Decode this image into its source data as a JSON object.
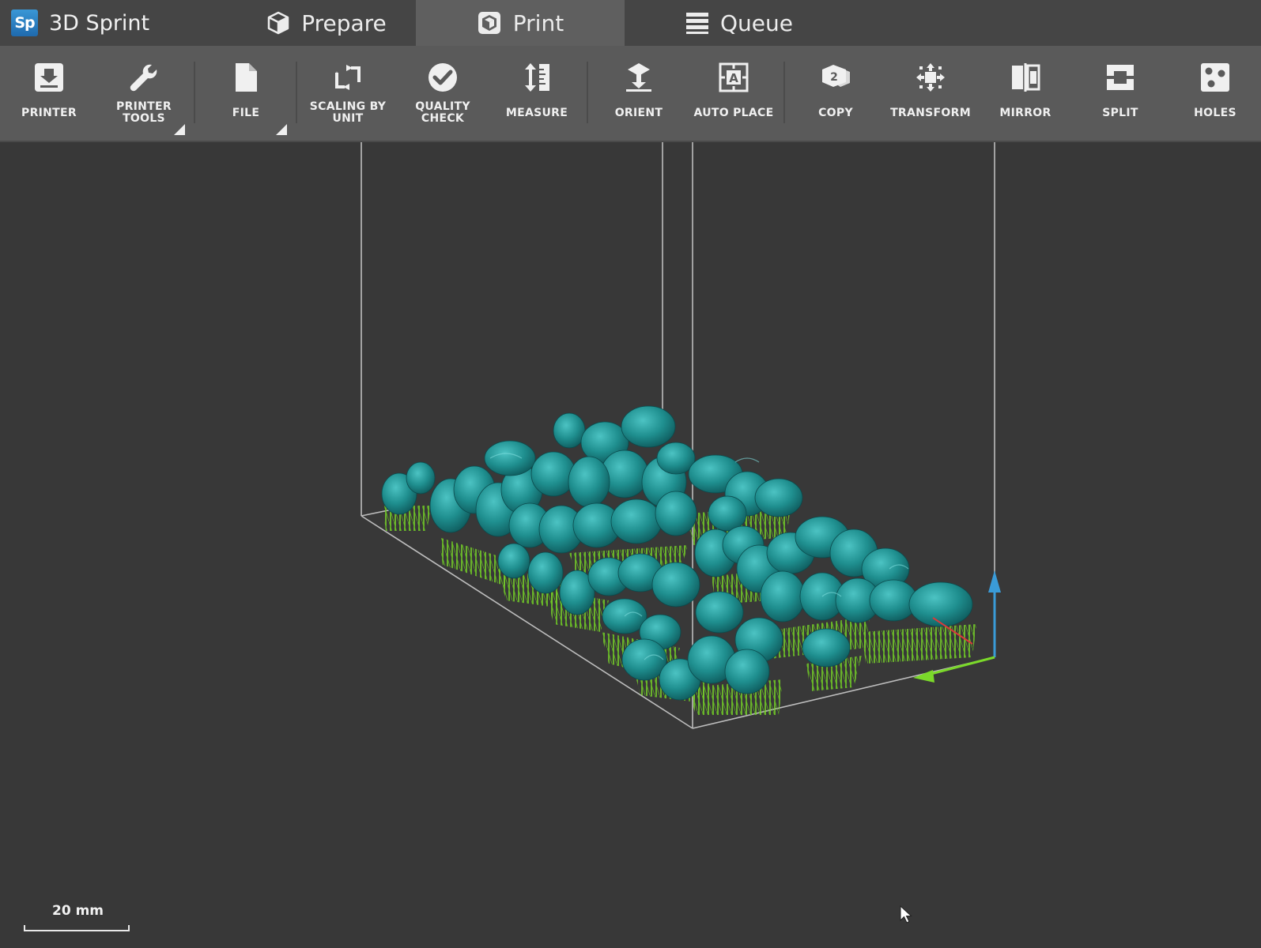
{
  "app": {
    "logo_text": "Sp",
    "title": "3D Sprint"
  },
  "tabs": [
    {
      "label": "Prepare",
      "icon": "cube-icon",
      "active": false
    },
    {
      "label": "Print",
      "icon": "print-cube-icon",
      "active": true
    },
    {
      "label": "Queue",
      "icon": "queue-list-icon",
      "active": false
    }
  ],
  "toolbar": {
    "printer": {
      "label": "PRINTER",
      "icon": "printer-icon"
    },
    "printer_tools": {
      "label_line1": "PRINTER",
      "label_line2": "TOOLS",
      "icon": "wrench-icon"
    },
    "file": {
      "label": "FILE",
      "icon": "file-icon"
    },
    "scaling_by_unit": {
      "label_line1": "SCALING BY",
      "label_line2": "UNIT",
      "icon": "scaling-icon"
    },
    "quality_check": {
      "label_line1": "QUALITY",
      "label_line2": "CHECK",
      "icon": "checkmark-icon"
    },
    "measure": {
      "label": "MEASURE",
      "icon": "measure-icon"
    },
    "orient": {
      "label": "ORIENT",
      "icon": "orient-icon"
    },
    "auto_place": {
      "label": "AUTO PLACE",
      "icon": "auto-place-icon"
    },
    "copy": {
      "label": "COPY",
      "icon": "copy-icon"
    },
    "transform": {
      "label": "TRANSFORM",
      "icon": "transform-icon"
    },
    "mirror": {
      "label": "MIRROR",
      "icon": "mirror-icon"
    },
    "split": {
      "label": "SPLIT",
      "icon": "split-icon"
    },
    "holes": {
      "label": "HOLES",
      "icon": "holes-icon"
    }
  },
  "viewport": {
    "scale_label": "20 mm",
    "model_color": "#1f8f8f",
    "support_color": "#7bd92a",
    "axis_z_color": "#3a9bd8",
    "axis_y_color": "#7bd92a",
    "axis_x_color": "#d83a3a"
  }
}
